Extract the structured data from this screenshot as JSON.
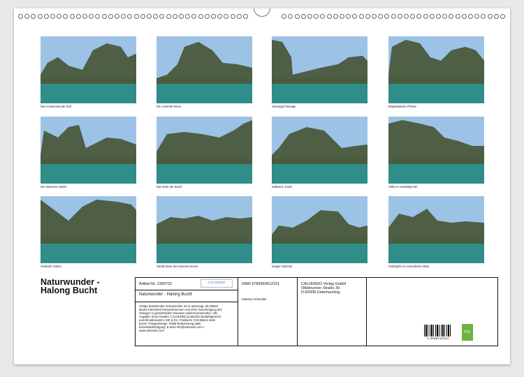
{
  "calendar_title": "Naturwunder - Halong Bucht",
  "photos": [
    {
      "caption": "Das schwimmende Dorf"
    },
    {
      "caption": "Der ruhende Riese"
    },
    {
      "caption": "Smaragd Passage"
    },
    {
      "caption": "Majestätische Pforten"
    },
    {
      "caption": "Die steinerne Nadel"
    },
    {
      "caption": "Das Erbe der Bucht"
    },
    {
      "caption": "Kalkstein Juwel"
    },
    {
      "caption": "Stille im Karstlabyrinth"
    },
    {
      "caption": "Vertikale Gärten"
    },
    {
      "caption": "Sanfte Brise des Drachenmeers"
    },
    {
      "caption": "Ewiger Wächter"
    },
    {
      "caption": "Farbtupfer im unendlichen Blau"
    }
  ],
  "panel": {
    "article_label": "Artikel-Nr. 2393722",
    "logo_text": "CALVENDO",
    "product_title": "Naturwunder - Halong Bucht",
    "legal_text": "Infolge bestehender Schutzrechte ist es untersagt, die Blätter dieses Kalenders herauszutrennen und ohne Genehmigung des Verlages zu gewerblichen Zwecken weiterzuverwenden. Alle Angaben ohne Gewähr. CALVENDO produziert bedarfsgerecht und klimabewusst in DE & EU. Positivere CO2-Bilanz dank kurzer Transportwege. Abfall-Reduzierung dank Einzelstückfertigung. E-Mail: info@calvendo.com • www.calvendo.com",
    "isbn": "ISBN 9783569512221",
    "author": "Katarina Schneider",
    "publisher_lines": [
      "CALVENDO Verlag GmbH",
      "Ottobrunner Straße 39",
      "D-82008 Unterhaching"
    ],
    "barcode_number": "9 783569 512221",
    "fsc_label": "FSC"
  },
  "colors": {
    "sky": "#9cc3e6",
    "water": "#2f8d8a",
    "rock": "#4a5a3c",
    "fsc_green": "#6cb33f"
  }
}
